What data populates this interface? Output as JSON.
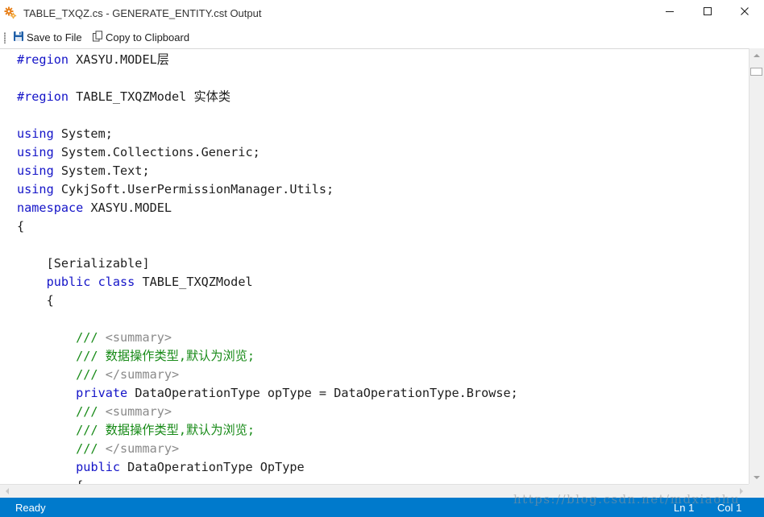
{
  "window": {
    "title": "TABLE_TXQZ.cs - GENERATE_ENTITY.cst Output",
    "app_icon": "gear-icon",
    "controls": [
      "minimize-icon",
      "maximize-icon",
      "close-icon"
    ]
  },
  "toolbar": {
    "save_label": "Save to File",
    "copy_label": "Copy to Clipboard"
  },
  "editor": {
    "lines": [
      [
        {
          "t": "#region ",
          "c": "k"
        },
        {
          "t": "XASYU.MODEL层",
          "c": ""
        }
      ],
      [],
      [
        {
          "t": "#region ",
          "c": "k"
        },
        {
          "t": "TABLE_TXQZModel 实体类",
          "c": ""
        }
      ],
      [],
      [
        {
          "t": "using",
          "c": "k"
        },
        {
          "t": " System;",
          "c": ""
        }
      ],
      [
        {
          "t": "using",
          "c": "k"
        },
        {
          "t": " System.Collections.Generic;",
          "c": ""
        }
      ],
      [
        {
          "t": "using",
          "c": "k"
        },
        {
          "t": " System.Text;",
          "c": ""
        }
      ],
      [
        {
          "t": "using",
          "c": "k"
        },
        {
          "t": " CykjSoft.UserPermissionManager.Utils;",
          "c": ""
        }
      ],
      [
        {
          "t": "namespace",
          "c": "k"
        },
        {
          "t": " XASYU.MODEL",
          "c": ""
        }
      ],
      [
        {
          "t": "{",
          "c": ""
        }
      ],
      [],
      [
        {
          "t": "    [Serializable]",
          "c": ""
        }
      ],
      [
        {
          "t": "    ",
          "c": ""
        },
        {
          "t": "public class",
          "c": "k"
        },
        {
          "t": " TABLE_TXQZModel",
          "c": ""
        }
      ],
      [
        {
          "t": "    {",
          "c": ""
        }
      ],
      [],
      [
        {
          "t": "        ///",
          "c": "c"
        },
        {
          "t": " <summary>",
          "c": "t"
        }
      ],
      [
        {
          "t": "        /// 数据操作类型,默认为浏览;",
          "c": "c"
        }
      ],
      [
        {
          "t": "        ///",
          "c": "c"
        },
        {
          "t": " </summary>",
          "c": "t"
        }
      ],
      [
        {
          "t": "        ",
          "c": ""
        },
        {
          "t": "private",
          "c": "k"
        },
        {
          "t": " DataOperationType opType = DataOperationType.Browse;",
          "c": ""
        }
      ],
      [
        {
          "t": "        ///",
          "c": "c"
        },
        {
          "t": " <summary>",
          "c": "t"
        }
      ],
      [
        {
          "t": "        /// 数据操作类型,默认为浏览;",
          "c": "c"
        }
      ],
      [
        {
          "t": "        ///",
          "c": "c"
        },
        {
          "t": " </summary>",
          "c": "t"
        }
      ],
      [
        {
          "t": "        ",
          "c": ""
        },
        {
          "t": "public",
          "c": "k"
        },
        {
          "t": " DataOperationType OpType",
          "c": ""
        }
      ],
      [
        {
          "t": "        {",
          "c": ""
        }
      ]
    ]
  },
  "statusbar": {
    "status": "Ready",
    "line": "Ln 1",
    "column": "Col 1"
  },
  "watermark": "https://blog.csdn.net/mdxiaohu",
  "colors": {
    "keyword": "#1414c8",
    "comment": "#178a17",
    "xml_tag": "#8a8a8a",
    "statusbar": "#007acc"
  }
}
